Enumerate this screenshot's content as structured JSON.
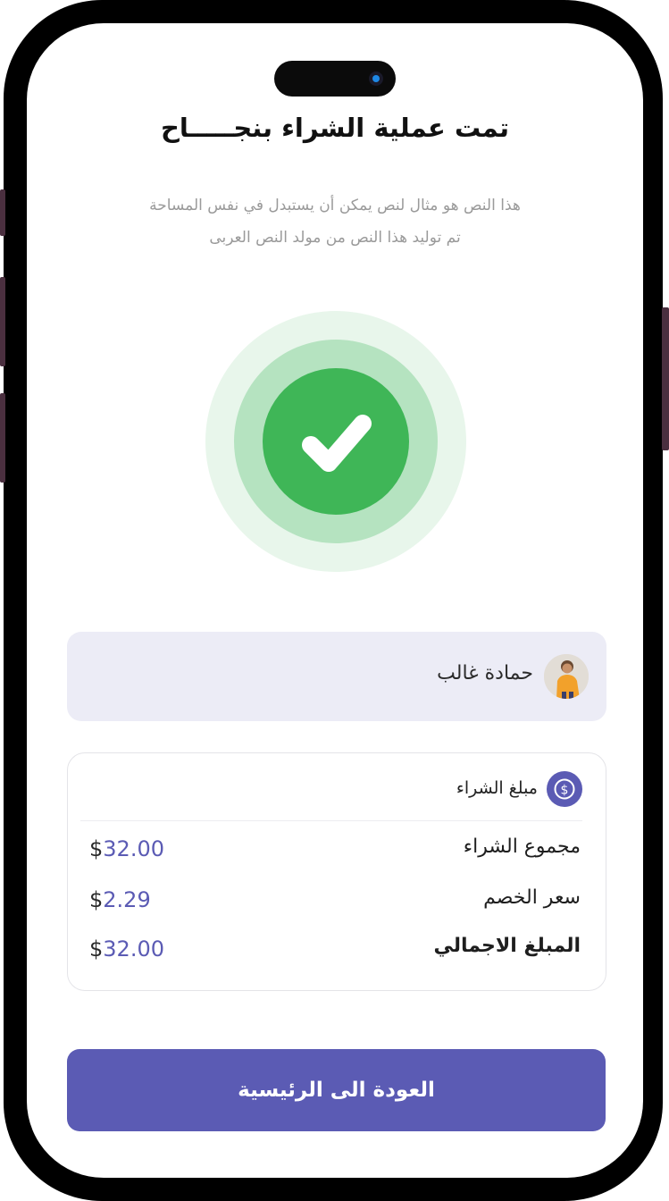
{
  "header": {
    "title": "تمت عملية الشراء بنجـــــاح",
    "subtitle_line1": "هذا النص هو مثال لنص يمكن أن يستبدل في نفس المساحة",
    "subtitle_line2": "تم توليد هذا النص من مولد النص العربى"
  },
  "status": {
    "icon": "check-icon",
    "color": "#3fb657"
  },
  "user": {
    "name": "حمادة غالب",
    "avatar_icon": "user-avatar"
  },
  "summary": {
    "heading": "مبلغ الشراء",
    "icon": "dollar-icon",
    "rows": [
      {
        "label": "مجموع الشراء",
        "currency": "$",
        "amount": "32.00"
      },
      {
        "label": "سعر الخصم",
        "currency": "$",
        "amount": "2.29"
      },
      {
        "label": "المبلغ الاجمالي",
        "currency": "$",
        "amount": "32.00"
      }
    ]
  },
  "actions": {
    "home_label": "العودة الى الرئيسية"
  },
  "colors": {
    "accent": "#5b5bb4",
    "success": "#3fb657",
    "card_bg": "#ececf6"
  }
}
